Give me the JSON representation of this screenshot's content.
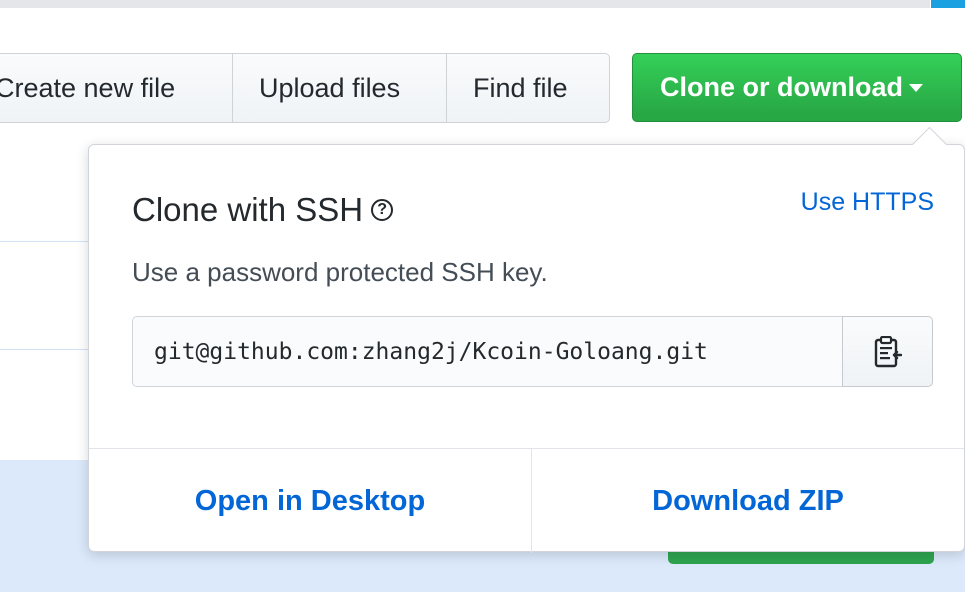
{
  "toolbar": {
    "create_new_file": "Create new file",
    "upload_files": "Upload files",
    "find_file": "Find file",
    "clone_or_download": "Clone or download"
  },
  "clone_panel": {
    "title": "Clone with SSH",
    "help_icon": "question-circle-icon",
    "toggle_link": "Use HTTPS",
    "subtitle": "Use a password protected SSH key.",
    "clone_url": "git@github.com:zhang2j/Kcoin-Goloang.git",
    "copy_icon": "clipboard-icon",
    "open_desktop": "Open in Desktop",
    "download_zip": "Download ZIP"
  },
  "colors": {
    "primary_green": "#2ea44f",
    "link_blue": "#0366d6",
    "text": "#24292e",
    "row_highlight": "#dbe9fb"
  }
}
